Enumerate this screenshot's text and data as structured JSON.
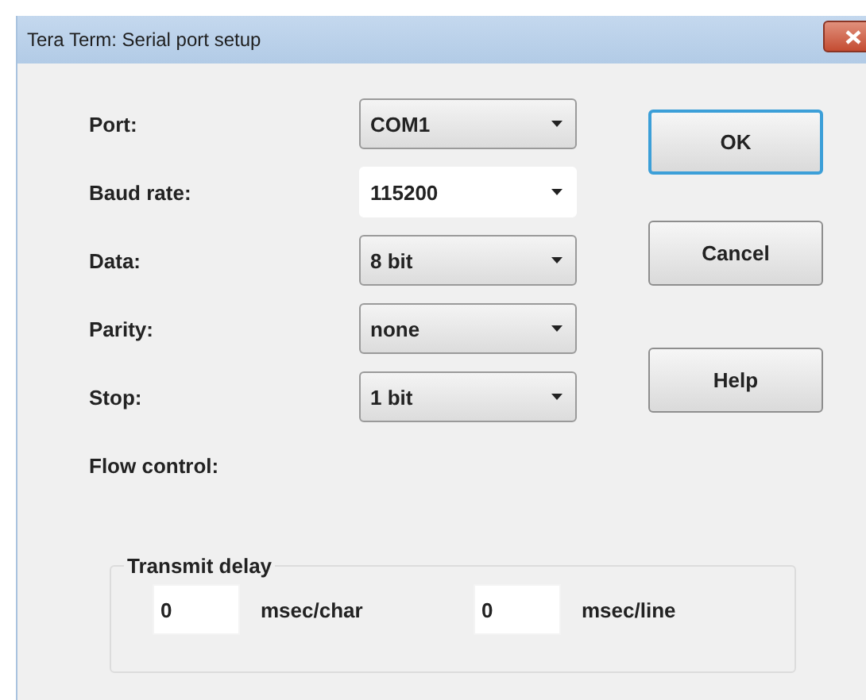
{
  "window": {
    "title": "Tera Term: Serial port setup"
  },
  "fields": [
    {
      "label": "Port:",
      "kind": "select",
      "value": "COM1"
    },
    {
      "label": "Baud rate:",
      "kind": "editable",
      "value": "115200"
    },
    {
      "label": "Data:",
      "kind": "select",
      "value": "8 bit"
    },
    {
      "label": "Parity:",
      "kind": "select",
      "value": "none"
    },
    {
      "label": "Stop:",
      "kind": "select",
      "value": "1 bit"
    },
    {
      "label": "Flow control:",
      "kind": "none"
    }
  ],
  "buttons": [
    {
      "label": "OK",
      "default": true
    },
    {
      "label": "Cancel",
      "default": false
    },
    {
      "label": "Help",
      "default": false
    }
  ],
  "transmit_delay": {
    "title": "Transmit delay",
    "inputs": [
      {
        "value": "0",
        "unit": "msec/char"
      },
      {
        "value": "0",
        "unit": "msec/line"
      }
    ]
  }
}
